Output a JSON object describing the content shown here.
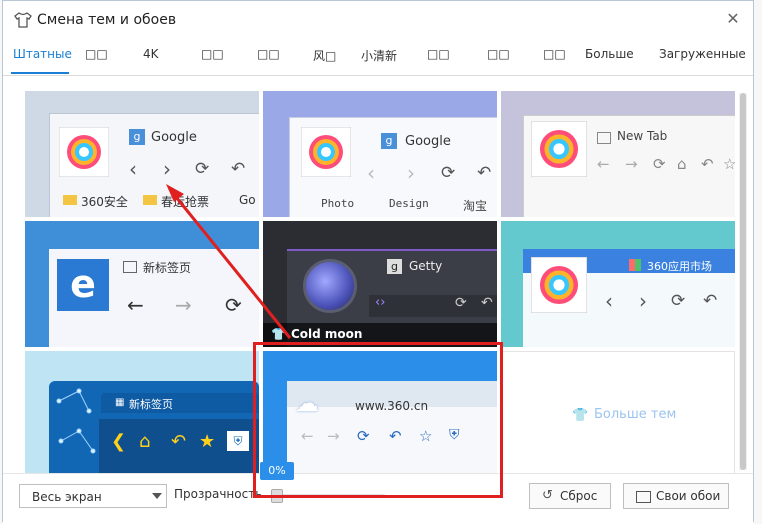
{
  "window": {
    "title": "Смена тем и обоев",
    "close_glyph": "✕"
  },
  "tabs": [
    {
      "label": "Штатные",
      "active": true
    },
    {
      "label": "□□"
    },
    {
      "label": "4K"
    },
    {
      "label": "□□"
    },
    {
      "label": "□□"
    },
    {
      "label": "风□"
    },
    {
      "label": "小清新"
    },
    {
      "label": "□□"
    },
    {
      "label": "□□"
    },
    {
      "label": "Больше"
    },
    {
      "label": "Загруженные"
    }
  ],
  "themes": [
    {
      "address_text": "Google",
      "bookmarks": [
        "360安全",
        "春运抢票",
        "Go"
      ]
    },
    {
      "address_text": "Google",
      "bookmarks": [
        "Photo",
        "Design",
        "淘宝"
      ]
    },
    {
      "address_text": "New Tab"
    },
    {
      "address_text": "新标签页"
    },
    {
      "address_text": "Getty",
      "caption": "Cold moon"
    },
    {
      "address_text": "360应用市场"
    },
    {
      "address_text": "新标签页"
    },
    {
      "address_text": "www.360.cn"
    },
    {
      "more_label": "Больше тем"
    }
  ],
  "footer": {
    "display_mode": "Весь экран",
    "opacity_label": "Прозрачность",
    "opacity_value": "0%",
    "reset_label": "Сброс",
    "own_wallpaper_label": "Свои обои"
  },
  "colors": {
    "accent": "#1a7fd6",
    "highlight": "#e02020"
  }
}
